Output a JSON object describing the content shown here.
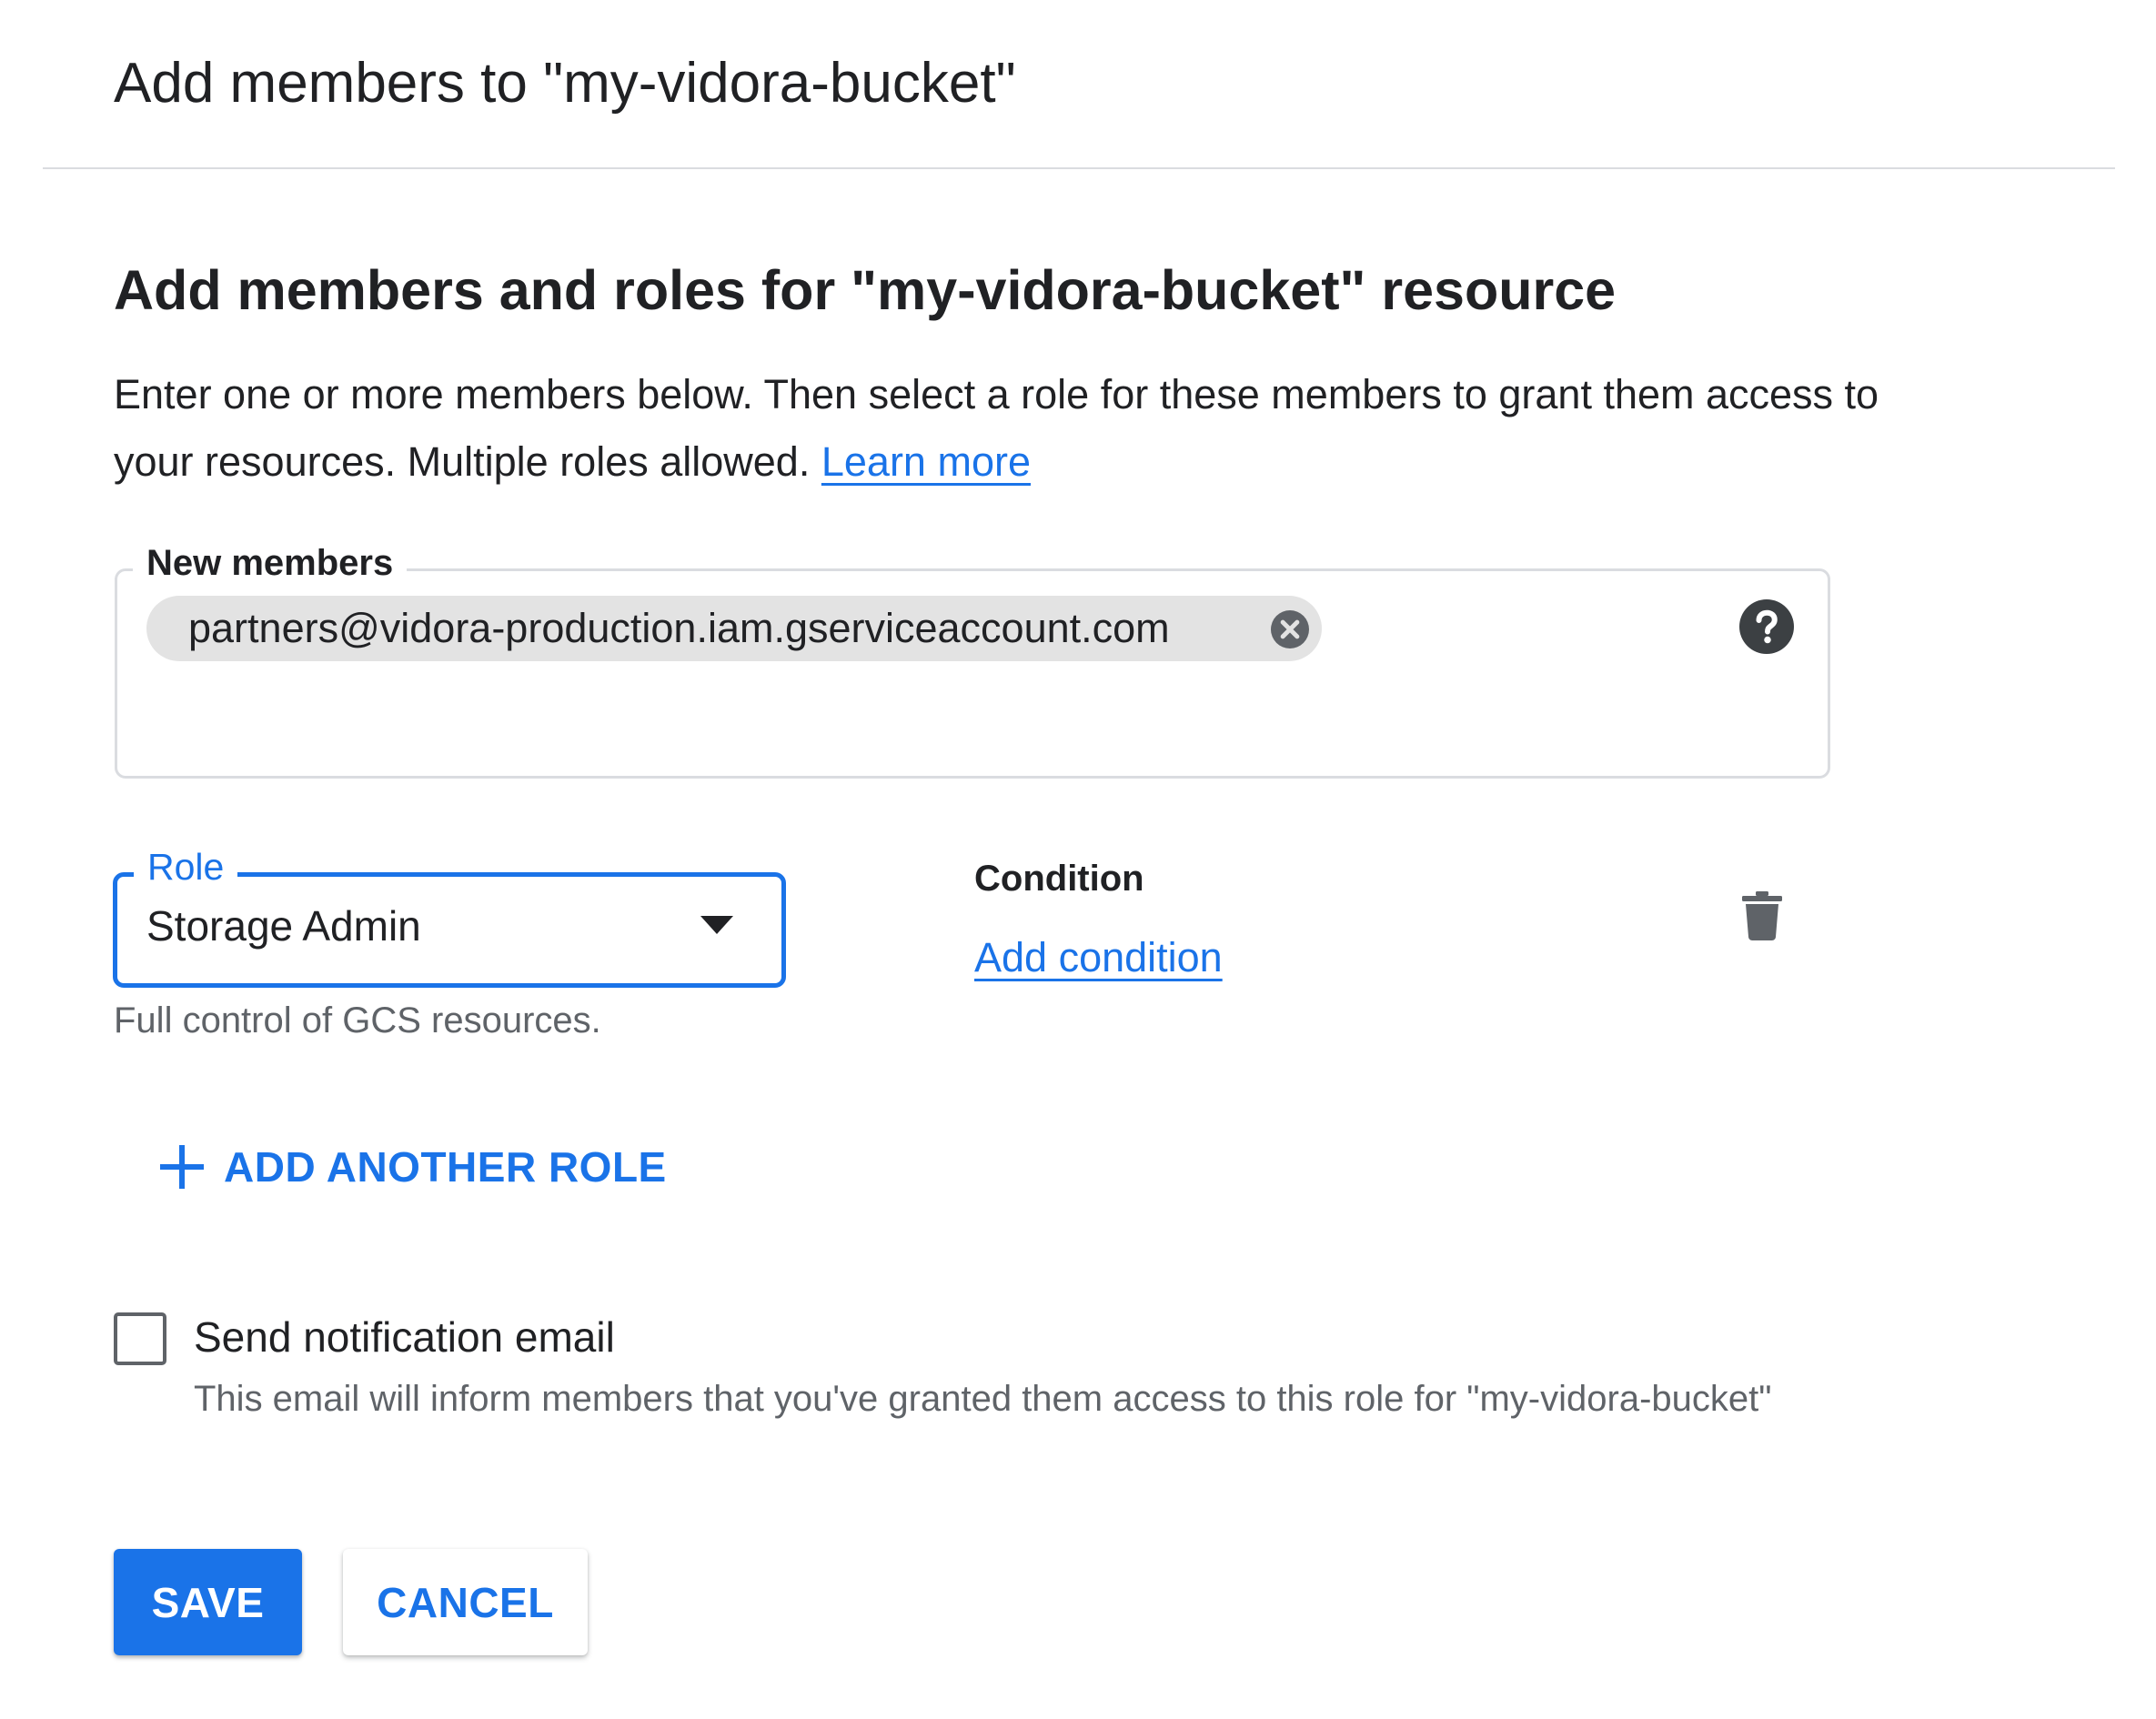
{
  "dialog": {
    "title": "Add members to \"my-vidora-bucket\""
  },
  "section": {
    "heading": "Add members and roles for \"my-vidora-bucket\" resource",
    "description": "Enter one or more members below. Then select a role for these members to grant them access to your resources. Multiple roles allowed.",
    "learn_more": "Learn more"
  },
  "members": {
    "label": "New members",
    "chips": [
      {
        "value": "partners@vidora-production.iam.gserviceaccount.com"
      }
    ],
    "help_icon": "help-circle-icon",
    "remove_icon": "cancel-circle-icon"
  },
  "role": {
    "label": "Role",
    "selected": "Storage Admin",
    "hint": "Full control of GCS resources.",
    "dropdown_icon": "arrow-drop-down-icon"
  },
  "condition": {
    "title": "Condition",
    "link": "Add condition",
    "delete_icon": "trash-icon"
  },
  "add_role": {
    "label": "ADD ANOTHER ROLE",
    "icon": "plus-icon"
  },
  "notification": {
    "label": "Send notification email",
    "hint": "This email will inform members that you've granted them access to this role for \"my-vidora-bucket\"",
    "checked": false
  },
  "actions": {
    "save": "SAVE",
    "cancel": "CANCEL"
  },
  "colors": {
    "accent": "#1a73e8",
    "text": "#202124",
    "secondary_text": "#5f6368",
    "divider": "#dadce0",
    "chip_bg": "#e3e3e3"
  }
}
